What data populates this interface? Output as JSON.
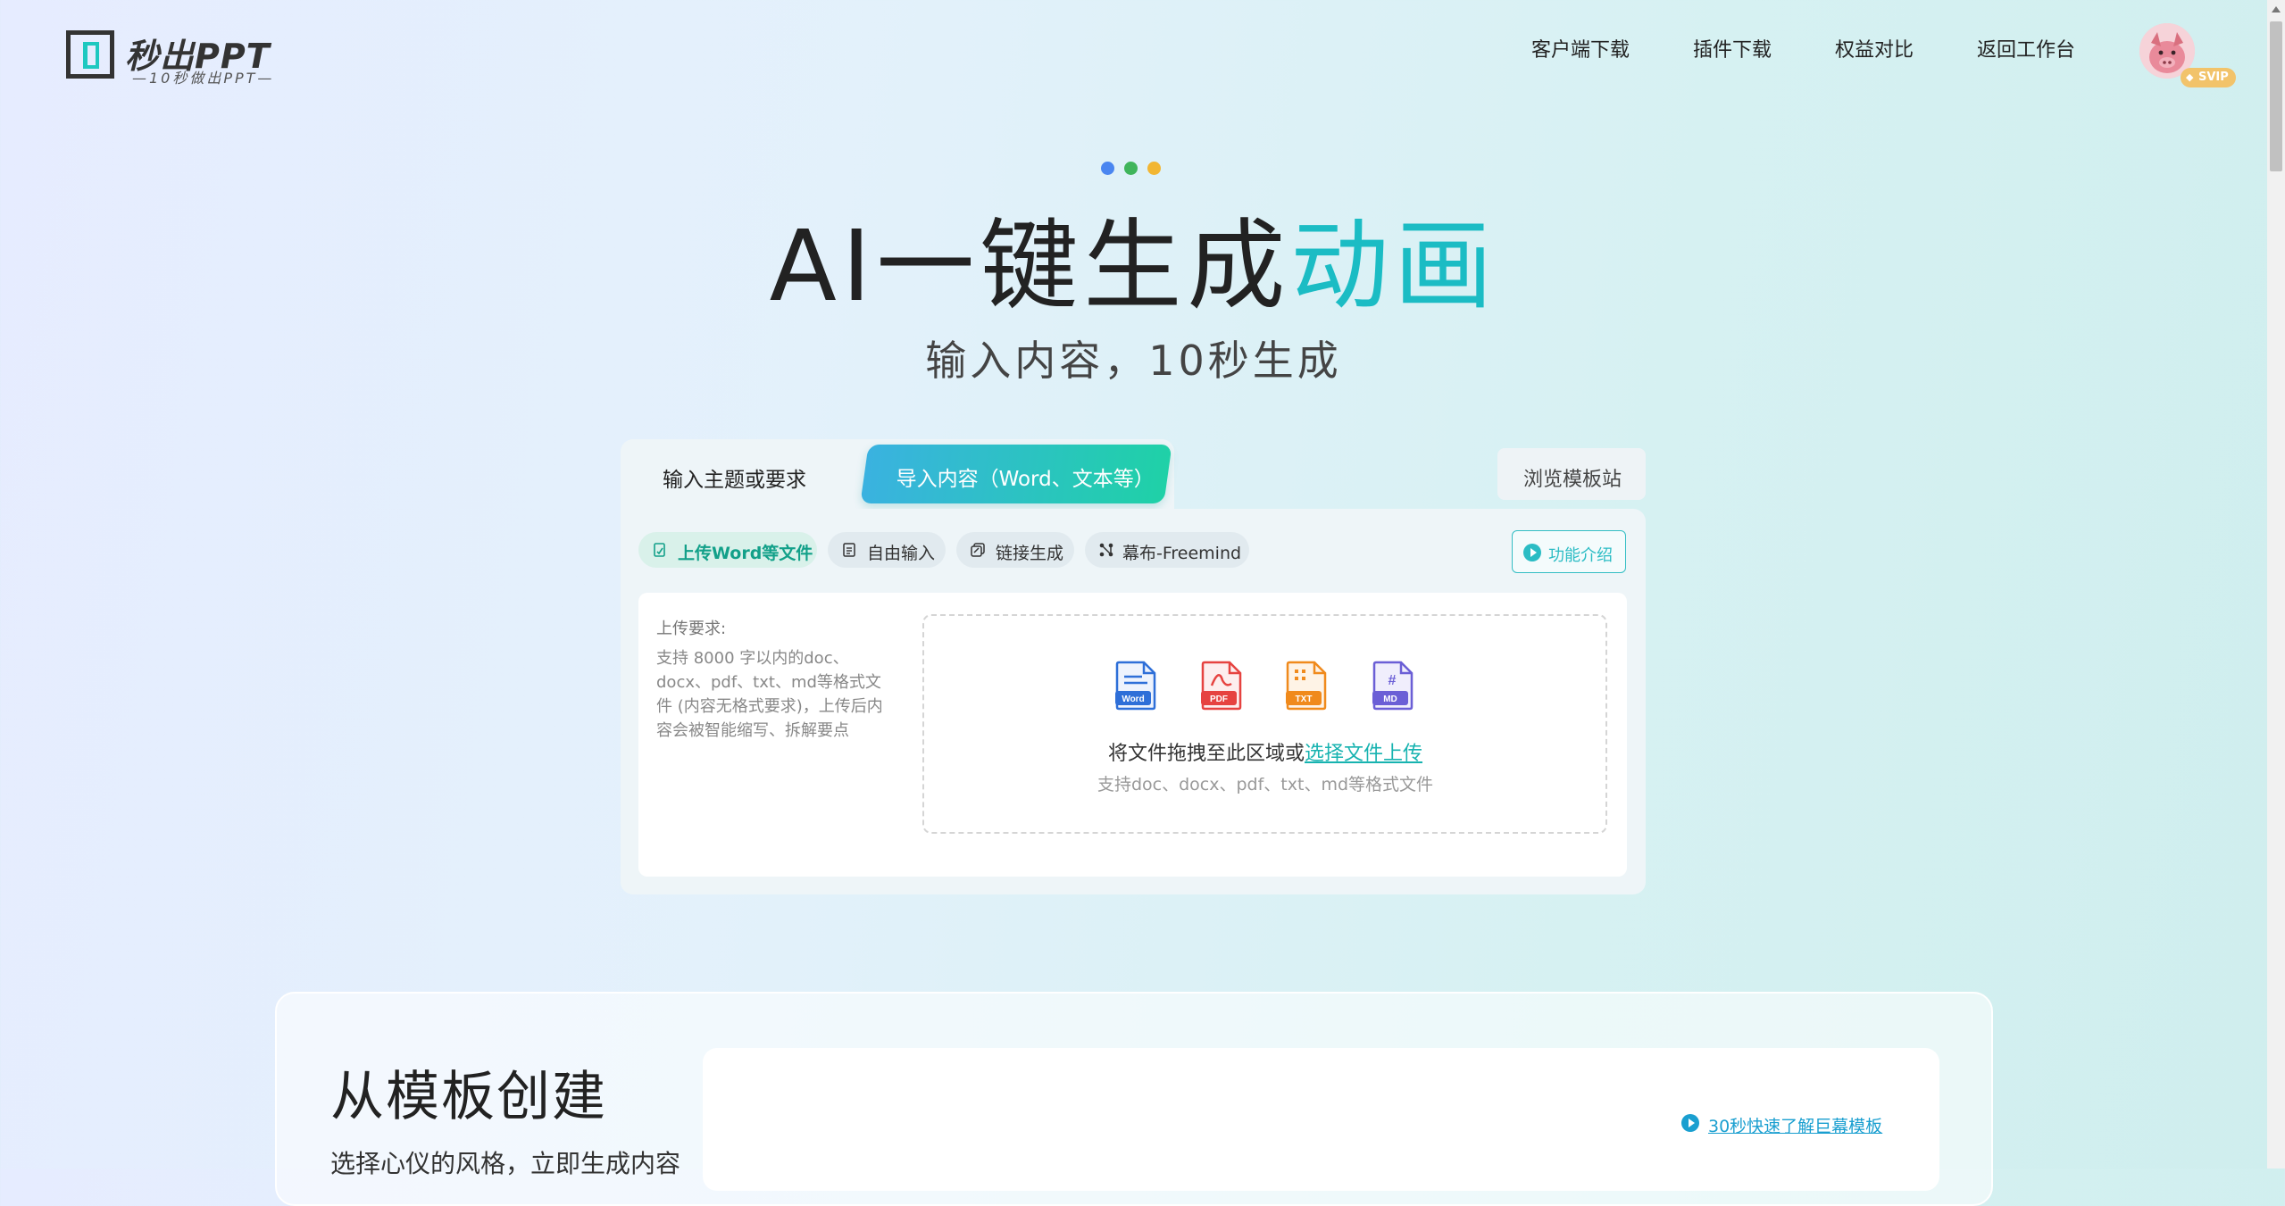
{
  "header": {
    "logo_name": "秒出PPT",
    "logo_sub": "—10秒做出PPT—",
    "nav": [
      "客户端下载",
      "插件下载",
      "权益对比",
      "返回工作台"
    ],
    "badge": "SVIP"
  },
  "hero": {
    "title_main": "AI一键生成",
    "title_accent": "动画",
    "subtitle": "输入内容，10秒生成",
    "dot_colors": [
      "#4a86f0",
      "#3fb55b",
      "#f2b632"
    ]
  },
  "tabs": {
    "topic": "输入主题或要求",
    "import": "导入内容（Word、文本等）",
    "browse": "浏览模板站"
  },
  "chips": [
    "上传Word等文件",
    "自由输入",
    "链接生成",
    "幕布-Freemind"
  ],
  "intro_button": "功能介绍",
  "upload": {
    "req_title": "上传要求:",
    "req_body": "支持 8000 字以内的doc、docx、pdf、txt、md等格式文件 (内容无格式要求)，上传后内容会被智能缩写、拆解要点",
    "file_types": [
      "Word",
      "PDF",
      "TXT",
      "MD"
    ],
    "drop_text": "将文件拖拽至此区域或",
    "drop_link": "选择文件上传",
    "drop_hint": "支持doc、docx、pdf、txt、md等格式文件"
  },
  "template_section": {
    "title": "从模板创建",
    "subtitle": "选择心仪的风格，立即生成内容",
    "quick_link": "30秒快速了解巨幕模板"
  },
  "colors": {
    "accent": "#1bbcc4",
    "tab_gradient_start": "#3ab2e0",
    "tab_gradient_end": "#1fd1a7",
    "word": "#2e6fd8",
    "pdf": "#e64340",
    "txt": "#f08a1c",
    "md": "#6b5fd6"
  }
}
